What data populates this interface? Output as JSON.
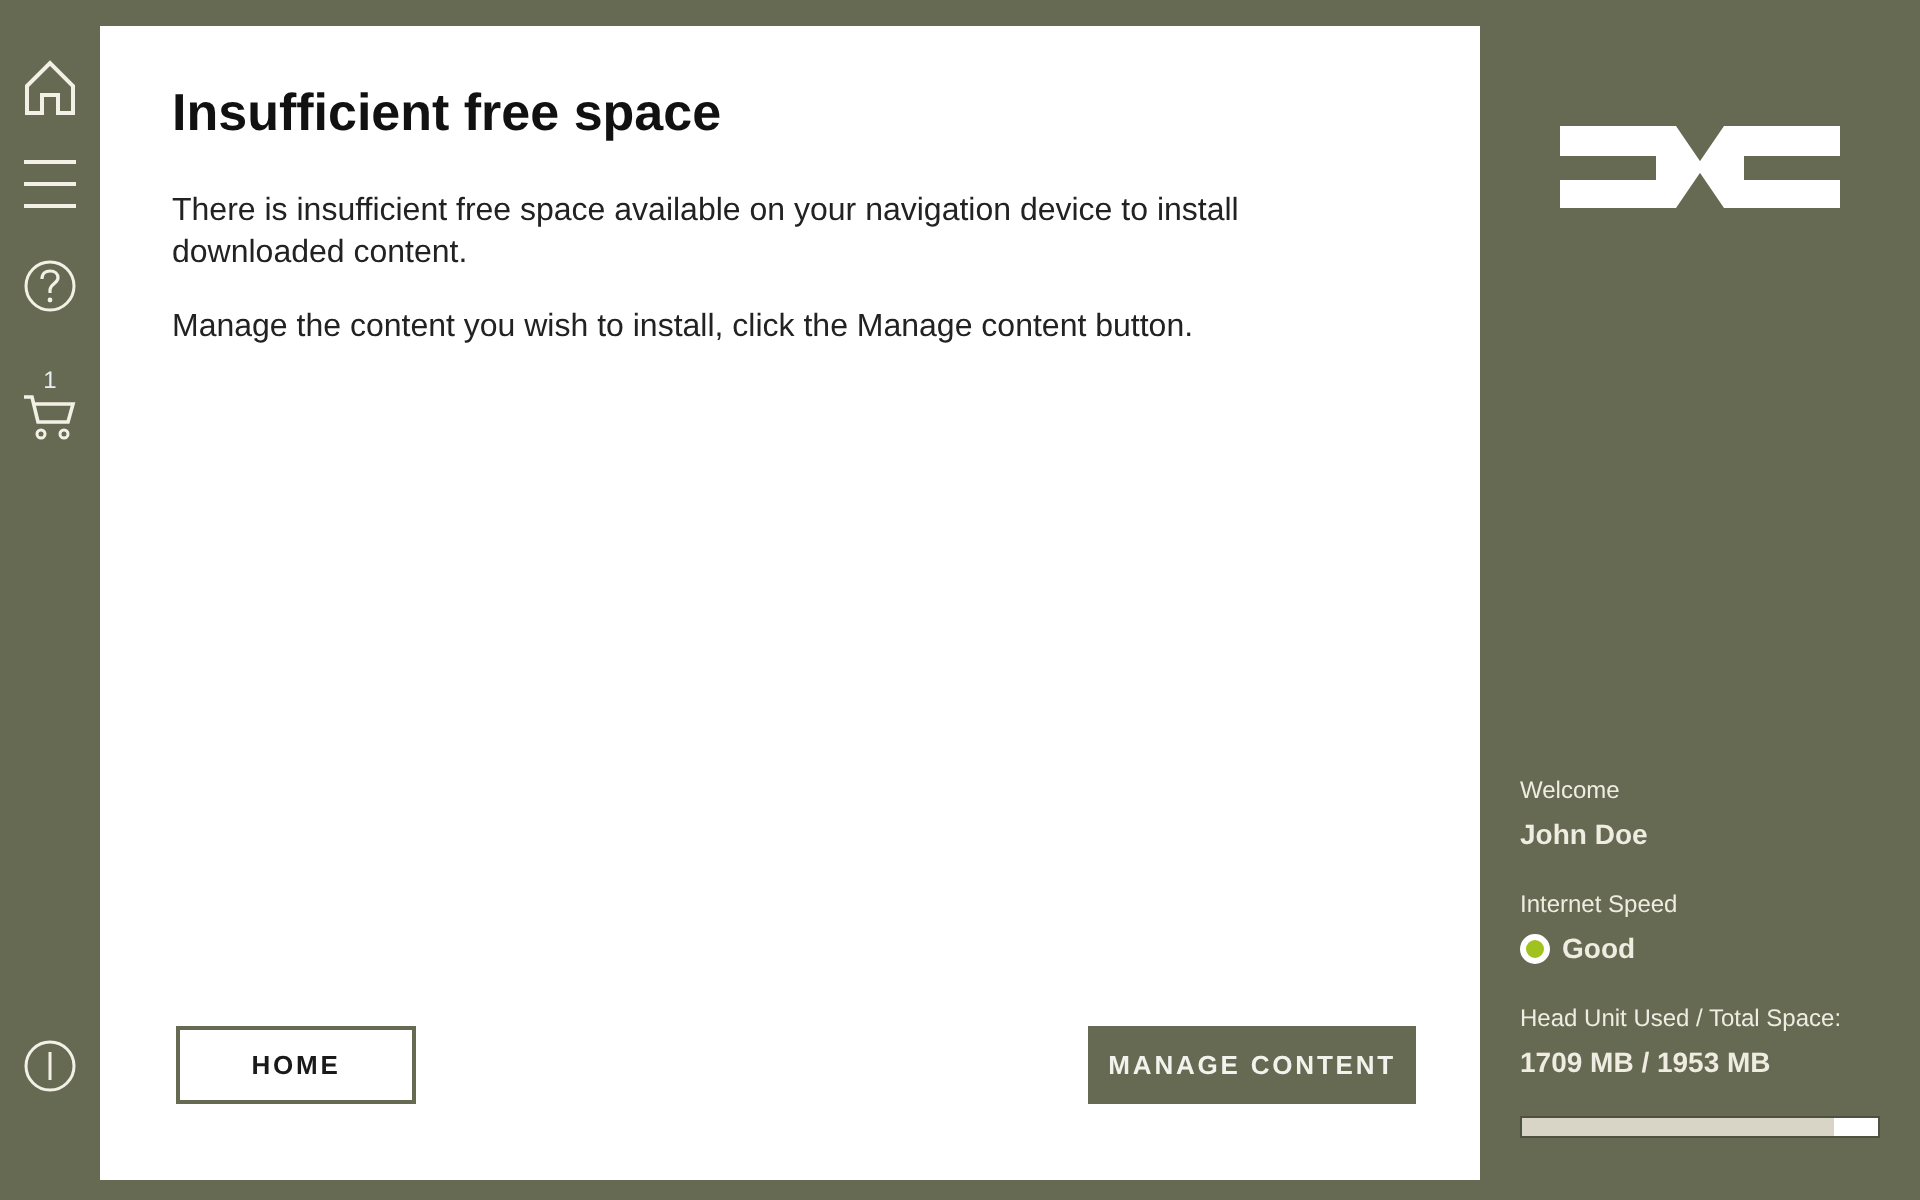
{
  "sidebar": {
    "cart_badge": "1"
  },
  "dialog": {
    "title": "Insufficient free space",
    "paragraphs": [
      "There is insufficient free space available on your navigation device to install downloaded content.",
      "Manage the content you wish to install, click the Manage content button."
    ],
    "buttons": [
      {
        "label": "HOME",
        "kind": "outline"
      },
      {
        "label": "MANAGE CONTENT",
        "kind": "primary"
      }
    ]
  },
  "status_panel": {
    "welcome_label": "Welcome",
    "user_name": "John Doe",
    "internet_speed": {
      "label": "Internet Speed",
      "value": "Good",
      "color": "#9fc21e"
    },
    "storage": {
      "label": "Head Unit Used / Total Space:",
      "reading": "1709 MB / 1953 MB",
      "level": 0.875
    }
  }
}
